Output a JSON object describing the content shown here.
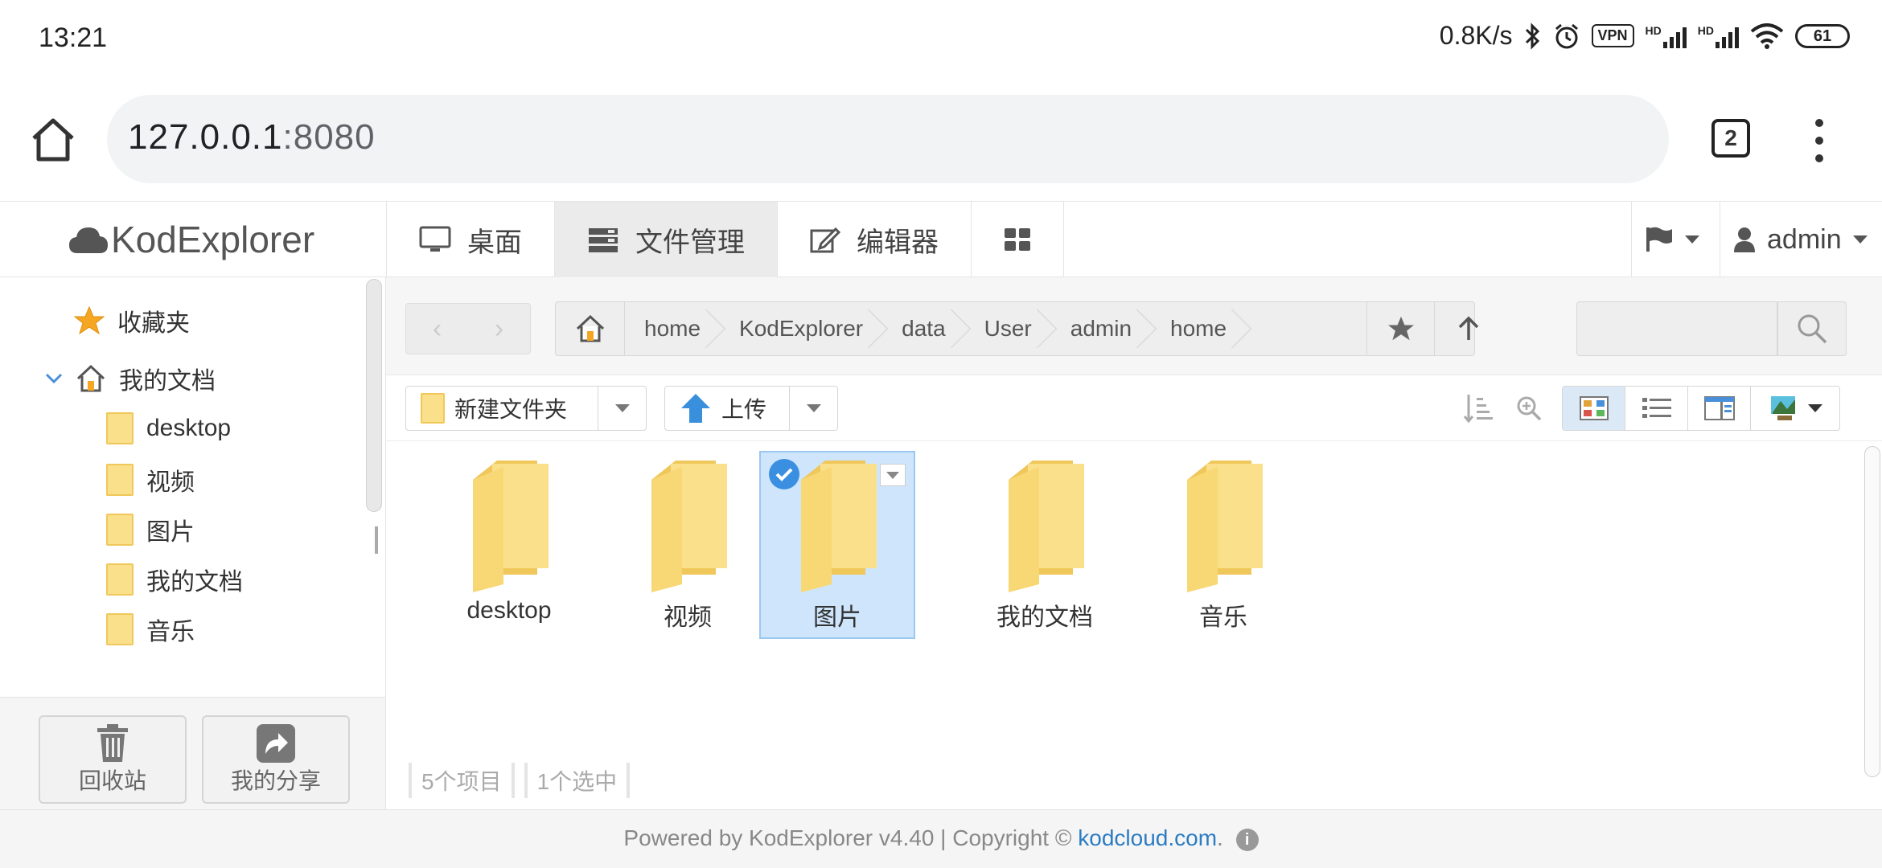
{
  "status_bar": {
    "time": "13:21",
    "net_speed": "0.8K/s",
    "vpn": "VPN",
    "hd": "HD",
    "battery": "61"
  },
  "browser": {
    "url_host": "127.0.0.1",
    "url_port": ":8080",
    "tab_count": "2"
  },
  "app": {
    "logo": "KodExplorer",
    "nav_tabs": [
      {
        "label": "桌面",
        "icon": "monitor-icon"
      },
      {
        "label": "文件管理",
        "icon": "file-manager-icon"
      },
      {
        "label": "编辑器",
        "icon": "editor-icon"
      }
    ],
    "user": "admin"
  },
  "sidebar": {
    "favorites": "收藏夹",
    "my_docs": "我的文档",
    "folders": [
      "desktop",
      "视频",
      "图片",
      "我的文档",
      "音乐"
    ],
    "recycle": "回收站",
    "my_share": "我的分享"
  },
  "breadcrumb": [
    "home",
    "KodExplorer",
    "data",
    "User",
    "admin",
    "home"
  ],
  "toolbar": {
    "new_folder": "新建文件夹",
    "upload": "上传"
  },
  "files": [
    {
      "name": "desktop",
      "selected": false
    },
    {
      "name": "视频",
      "selected": false
    },
    {
      "name": "图片",
      "selected": true
    },
    {
      "name": "我的文档",
      "selected": false
    },
    {
      "name": "音乐",
      "selected": false
    }
  ],
  "status": {
    "count": "5个项目",
    "selected": "1个选中"
  },
  "footer": {
    "text": "Powered by KodExplorer v4.40 | Copyright ©",
    "link": "kodcloud.com",
    "dot": "."
  },
  "colors": {
    "folder": "#f8d775",
    "selection": "#cfe5fb",
    "link": "#2b7cc2"
  }
}
